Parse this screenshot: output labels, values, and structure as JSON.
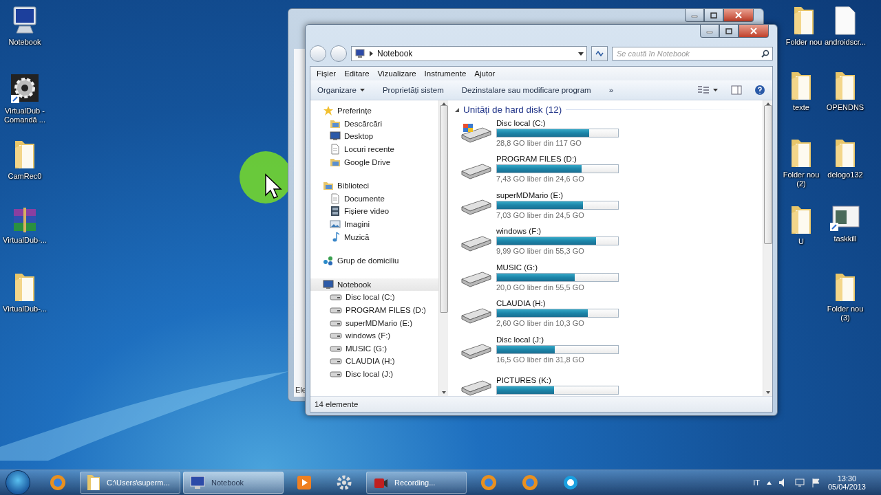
{
  "desktop_icons": [
    {
      "label": "Notebook",
      "kind": "computer"
    },
    {
      "label": "VirtualDub - Comandă ...",
      "kind": "program"
    },
    {
      "label": "CamRec0",
      "kind": "folder"
    },
    {
      "label": "VirtualDub-...",
      "kind": "archive"
    },
    {
      "label": "VirtualDub-...",
      "kind": "folder"
    },
    {
      "label": "Folder nou",
      "kind": "folder"
    },
    {
      "label": "texte",
      "kind": "folder"
    },
    {
      "label": "Folder nou (2)",
      "kind": "folder"
    },
    {
      "label": "U",
      "kind": "folder"
    },
    {
      "label": "androidscr...",
      "kind": "file"
    },
    {
      "label": "OPENDNS",
      "kind": "folder"
    },
    {
      "label": "delogo132",
      "kind": "folder"
    },
    {
      "label": "taskkill",
      "kind": "shortcut"
    },
    {
      "label": "Folder nou (3)",
      "kind": "folder"
    }
  ],
  "background_window": {
    "status": "Ele"
  },
  "window": {
    "address": "Notebook",
    "search": {
      "placeholder": "Se caută în Notebook"
    },
    "menu": [
      "Fișier",
      "Editare",
      "Vizualizare",
      "Instrumente",
      "Ajutor"
    ],
    "toolbar": [
      "Organizare",
      "Proprietăți sistem",
      "Dezinstalare sau modificare program",
      "»"
    ],
    "sidebar": [
      {
        "label": "Preferințe",
        "kind": "star",
        "selected": false,
        "children": [
          {
            "label": "Descărcări",
            "kind": "folder",
            "selected": false
          },
          {
            "label": "Desktop",
            "kind": "monitor",
            "selected": false
          },
          {
            "label": "Locuri recente",
            "kind": "document",
            "selected": false
          },
          {
            "label": "Google Drive",
            "kind": "folder",
            "selected": false
          }
        ]
      },
      {
        "label": "Biblioteci",
        "kind": "folder",
        "selected": false,
        "children": [
          {
            "label": "Documente",
            "kind": "document",
            "selected": false
          },
          {
            "label": "Fișiere video",
            "kind": "film",
            "selected": false
          },
          {
            "label": "Imagini",
            "kind": "picture",
            "selected": false
          },
          {
            "label": "Muzică",
            "kind": "music",
            "selected": false
          }
        ]
      },
      {
        "label": "Grup de domiciliu",
        "kind": "network",
        "selected": false
      },
      {
        "label": "Notebook",
        "kind": "monitor",
        "selected": true,
        "children": [
          {
            "label": "Disc local (C:)",
            "kind": "drive",
            "selected": false
          },
          {
            "label": "PROGRAM FILES (D:)",
            "kind": "drive",
            "selected": false
          },
          {
            "label": "superMDMario (E:)",
            "kind": "drive",
            "selected": false
          },
          {
            "label": "windows (F:)",
            "kind": "drive",
            "selected": false
          },
          {
            "label": "MUSIC (G:)",
            "kind": "drive",
            "selected": false
          },
          {
            "label": "CLAUDIA (H:)",
            "kind": "drive",
            "selected": false
          },
          {
            "label": "Disc local (J:)",
            "kind": "drive",
            "selected": false
          }
        ]
      }
    ],
    "group": {
      "title": "Unități de hard disk (12)",
      "expanded": true
    },
    "drives": [
      {
        "name": "Disc local (C:)",
        "kind": "system",
        "level": 0.76,
        "free": "28,8 GO liber din 117 GO"
      },
      {
        "name": "PROGRAM FILES (D:)",
        "kind": "disk",
        "level": 0.7,
        "free": "7,43 GO liber din 24,6 GO"
      },
      {
        "name": "superMDMario (E:)",
        "kind": "disk",
        "level": 0.71,
        "free": "7,03 GO liber din 24,5 GO"
      },
      {
        "name": "windows (F:)",
        "kind": "disk",
        "level": 0.82,
        "free": "9,99 GO liber din 55,3 GO"
      },
      {
        "name": "MUSIC (G:)",
        "kind": "disk",
        "level": 0.64,
        "free": "20,0 GO liber din 55,5 GO"
      },
      {
        "name": "CLAUDIA (H:)",
        "kind": "disk",
        "level": 0.75,
        "free": "2,60 GO liber din 10,3 GO"
      },
      {
        "name": "Disc local (J:)",
        "kind": "disk",
        "level": 0.48,
        "free": "16,5 GO liber din 31,8 GO"
      },
      {
        "name": "PICTURES (K:)",
        "kind": "disk",
        "level": 0.47
      }
    ],
    "status_bar": "14 elemente"
  },
  "taskbar": {
    "items": [
      {
        "kind": "browser",
        "selected": false
      },
      {
        "label": "C:\\Users\\superm...",
        "kind": "folder",
        "selected": false
      },
      {
        "label": "Notebook",
        "kind": "computer",
        "selected": true
      },
      {
        "kind": "media",
        "selected": false
      },
      {
        "kind": "gear",
        "selected": false
      },
      {
        "label": "Recording...",
        "kind": "camera",
        "selected": false
      },
      {
        "kind": "browser",
        "selected": false
      },
      {
        "kind": "browser",
        "selected": false
      },
      {
        "kind": "chat",
        "selected": false
      }
    ],
    "language": "IT",
    "time": "13:30",
    "date": "05/04/2013"
  }
}
